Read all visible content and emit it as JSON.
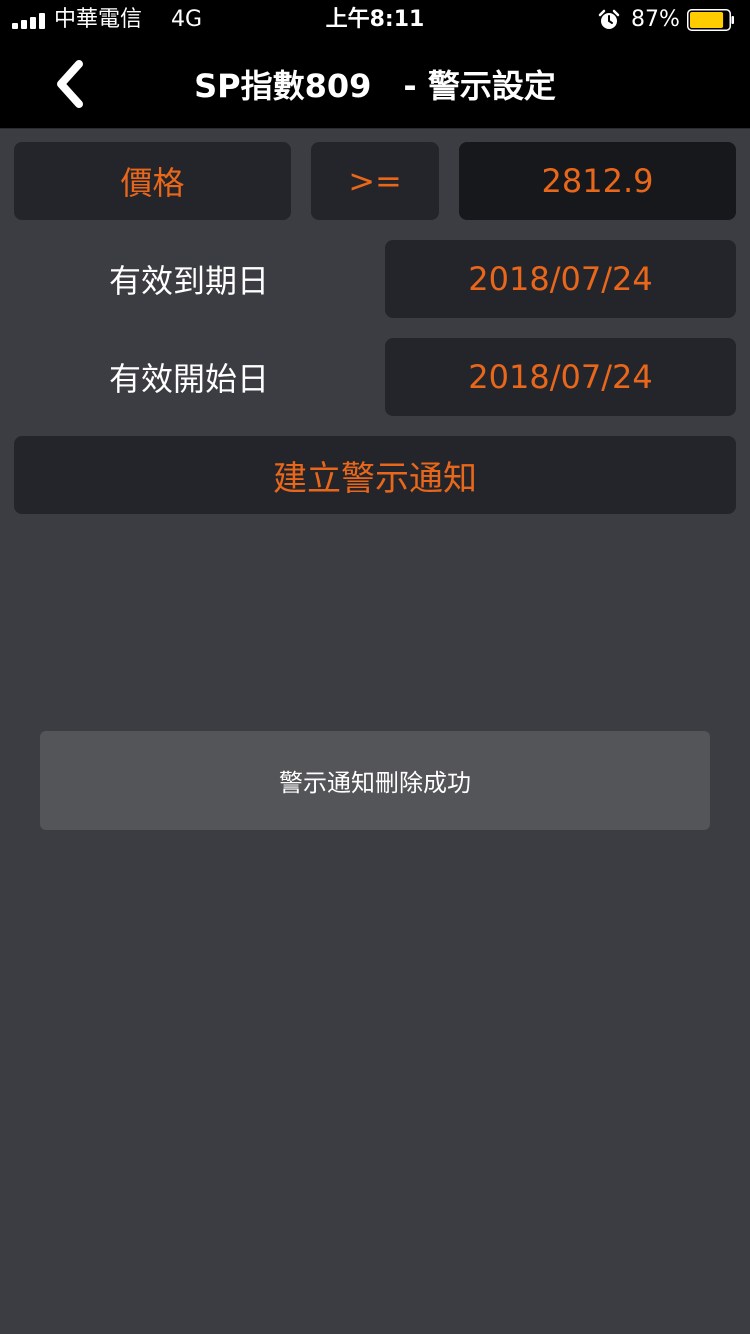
{
  "status_bar": {
    "carrier": "中華電信",
    "network": "4G",
    "time": "上午8:11",
    "battery_percent": "87%",
    "battery_level": 0.87,
    "icons": [
      "signal-icon",
      "alarm-icon",
      "battery-icon"
    ]
  },
  "nav": {
    "title": "SP指數809　- 警示設定",
    "back_icon": "chevron-left-icon"
  },
  "form": {
    "condition_field": "價格",
    "operator": ">=",
    "price_value": "2812.9",
    "expiry_label": "有效到期日",
    "expiry_date": "2018/07/24",
    "start_label": "有效開始日",
    "start_date": "2018/07/24",
    "create_button": "建立警示通知"
  },
  "toast": {
    "message": "警示通知刪除成功"
  },
  "colors": {
    "accent": "#e8671b",
    "background": "#3c3d42",
    "field": "#24252a",
    "bar": "#000000",
    "battery": "#ffcc00"
  }
}
